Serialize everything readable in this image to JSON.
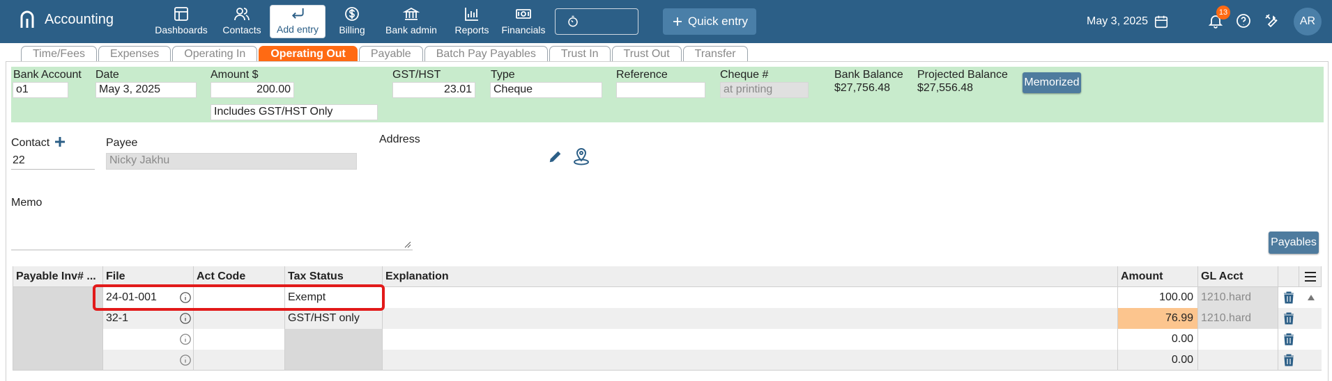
{
  "app": {
    "title": "Accounting"
  },
  "nav": [
    {
      "label": "Dashboards",
      "icon": "dashboard-icon"
    },
    {
      "label": "Contacts",
      "icon": "contacts-icon"
    },
    {
      "label": "Add entry",
      "icon": "return-arrow-icon"
    },
    {
      "label": "Billing",
      "icon": "dollar-icon"
    },
    {
      "label": "Bank admin",
      "icon": "bank-icon"
    },
    {
      "label": "Reports",
      "icon": "bar-chart-icon"
    },
    {
      "label": "Financials",
      "icon": "money-icon"
    }
  ],
  "header": {
    "quick_entry": "Quick entry",
    "date": "May 3, 2025",
    "notifications": "13",
    "avatar": "AR"
  },
  "tabs": [
    "Time/Fees",
    "Expenses",
    "Operating In",
    "Operating Out",
    "Payable",
    "Batch Pay Payables",
    "Trust In",
    "Trust Out",
    "Transfer"
  ],
  "active_tab": "Operating Out",
  "form": {
    "bank_account": {
      "label": "Bank Account",
      "value": "o1"
    },
    "date": {
      "label": "Date",
      "value": "May 3, 2025"
    },
    "amount": {
      "label": "Amount $",
      "value": "200.00"
    },
    "tax_option": "Includes GST/HST Only",
    "gst": {
      "label": "GST/HST",
      "value": "23.01"
    },
    "type": {
      "label": "Type",
      "value": "Cheque"
    },
    "reference": {
      "label": "Reference",
      "value": ""
    },
    "cheque": {
      "label": "Cheque #",
      "placeholder": "at printing"
    },
    "bank_balance": {
      "label": "Bank Balance",
      "value": "$27,756.48"
    },
    "projected_balance": {
      "label": "Projected Balance",
      "value": "$27,556.48"
    },
    "memorized": "Memorized"
  },
  "contact": {
    "contact_label": "Contact",
    "contact_value": "22",
    "payee_label": "Payee",
    "payee_value": "Nicky Jakhu",
    "address_label": "Address",
    "memo_label": "Memo",
    "payables_button": "Payables"
  },
  "table": {
    "headers": [
      "Payable Inv# ...",
      "File",
      "Act Code",
      "Tax Status",
      "Explanation",
      "Amount",
      "GL Acct"
    ],
    "rows": [
      {
        "inv": "",
        "file": "24-01-001",
        "act": "",
        "tax": "Exempt",
        "expl": "",
        "amount": "100.00",
        "gl": "1210.hard"
      },
      {
        "inv": "",
        "file": "32-1",
        "act": "",
        "tax": "GST/HST only",
        "expl": "",
        "amount": "76.99",
        "gl": "1210.hard"
      },
      {
        "inv": "",
        "file": "",
        "act": "",
        "tax": "",
        "expl": "",
        "amount": "0.00",
        "gl": ""
      },
      {
        "inv": "",
        "file": "",
        "act": "",
        "tax": "",
        "expl": "",
        "amount": "0.00",
        "gl": ""
      }
    ]
  },
  "colors": {
    "topbar": "#2c5f87",
    "accent": "#ff6a13",
    "green": "#c8ebcc",
    "highlight": "#e21a1a"
  }
}
